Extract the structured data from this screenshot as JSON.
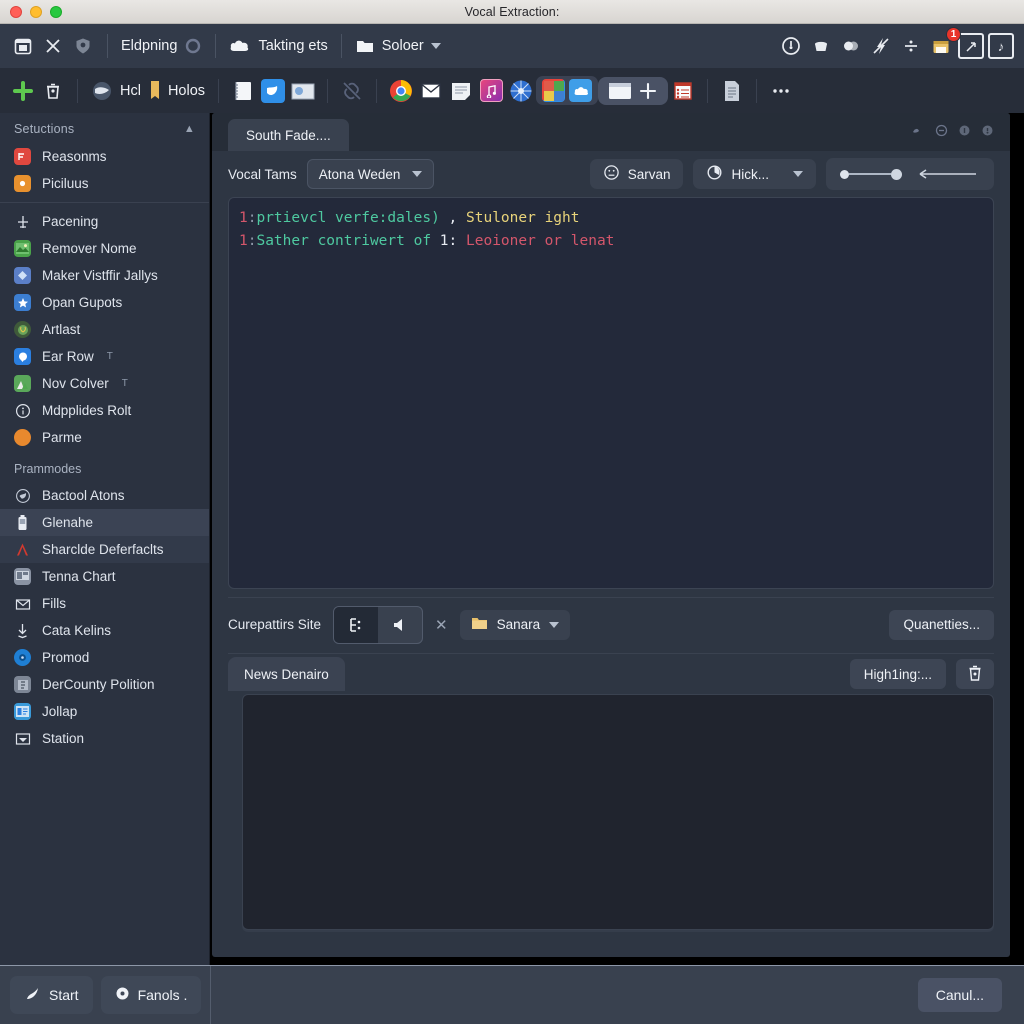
{
  "window": {
    "title": "Vocal Extraction:",
    "traffic_lights": [
      "close",
      "minimize",
      "zoom"
    ]
  },
  "toolbar_top": {
    "left_icons": [
      "calendar-icon",
      "close-icon",
      "shield-icon"
    ],
    "groups": [
      {
        "label": "Eldpning",
        "icon": "ring-icon"
      },
      {
        "label": "Takting ets",
        "icon": "cloud-icon"
      },
      {
        "label": "Soloer",
        "icon": "folder-icon",
        "caret": true
      }
    ],
    "right_icons": [
      "clock-icon",
      "bucket-icon",
      "contrast-icon",
      "flash-icon",
      "divide-icon",
      "archive-warning-icon",
      "expand-icon",
      "note-icon"
    ],
    "badge_count": "1"
  },
  "toolbar_second": {
    "add_icon": "plus-icon",
    "delete_icon": "trash-icon",
    "groups": [
      {
        "label": "Hcl",
        "icon": "globe-icon"
      },
      {
        "label": "Holos",
        "icon": "bookmark-icon"
      }
    ],
    "app_icons": [
      "notebook-icon",
      "blue-bird-icon",
      "photo-icon",
      "link-broken-icon",
      "chrome-icon",
      "mail-icon",
      "notes-icon",
      "music-icon",
      "compass-icon",
      "colors-icon",
      "cloud-app-icon"
    ],
    "window_group": [
      "window-icon",
      "plus-icon"
    ],
    "film_icon": "film-icon",
    "doc_icon": "document-icon",
    "overflow_icon": "more-icon"
  },
  "sidebar": {
    "section1_title": "Setuctions",
    "section1_collapse_icon": "chevron-up-icon",
    "group_a": [
      {
        "label": "Reasonms",
        "icon": "red-chart-icon",
        "color": "#e0483f"
      },
      {
        "label": "Piciluus",
        "icon": "orange-dot-icon",
        "color": "#e8912e"
      }
    ],
    "group_b": [
      {
        "label": "Pacening",
        "icon": "plane-icon",
        "color": "#2b3240"
      },
      {
        "label": "Remover Nome",
        "icon": "image-icon",
        "color": "#4aa34a"
      },
      {
        "label": "Maker Vistffir Jallys",
        "icon": "diamond-icon",
        "color": "#5b7fc7"
      },
      {
        "label": "Opan Gupots",
        "icon": "star-icon",
        "color": "#3c7ed1"
      },
      {
        "label": "Artlast",
        "icon": "brain-icon",
        "color": "#3f5a3a"
      },
      {
        "label": "Ear Row",
        "icon": "chat-icon",
        "color": "#2b7fe0",
        "suffix": "T"
      },
      {
        "label": "Nov Colver",
        "icon": "mountain-icon",
        "color": "#5aa85a",
        "suffix": "T"
      },
      {
        "label": "Mdpplides Rolt",
        "icon": "info-icon",
        "color": "#2b3240"
      },
      {
        "label": "Parme",
        "icon": "orange-circle-icon",
        "color": "#e8892e"
      }
    ],
    "section2_title": "Prammodes",
    "group_c": [
      {
        "label": "Bactool Atons",
        "icon": "bird-circle-icon",
        "color": "#2b3240"
      },
      {
        "label": "Glenahe",
        "icon": "battery-icon",
        "color": "#2b3240",
        "selected": true
      },
      {
        "label": "Sharclde Deferfaclts",
        "icon": "autocad-icon",
        "color": "#2b3240",
        "selected2": true
      },
      {
        "label": "Tenna Chart",
        "icon": "monitor-icon",
        "color": "#8a93a3"
      },
      {
        "label": "Fills",
        "icon": "envelope-icon",
        "color": "#2b3240"
      },
      {
        "label": "Cata Kelins",
        "icon": "download-icon",
        "color": "#2b3240"
      },
      {
        "label": "Promod",
        "icon": "blue-disc-icon",
        "color": "#1f7fd4"
      },
      {
        "label": "DerCounty Polition",
        "icon": "gray-card-icon",
        "color": "#7d8695"
      },
      {
        "label": "Jollap",
        "icon": "blue-card-icon",
        "color": "#3a9ad9"
      },
      {
        "label": "Station",
        "icon": "check-box-icon",
        "color": "#2b3240"
      }
    ]
  },
  "main": {
    "tab_label": "South Fade....",
    "tab_icons": [
      "mask-icon",
      "minus-circle-icon",
      "left-dot-icon",
      "right-dot-icon"
    ],
    "toolbar": {
      "field_label": "Vocal Tams",
      "select_value": "Atona Weden",
      "button_label": "Sarvan",
      "button_icon": "face-clock-icon",
      "dropdown_label": "Hick...",
      "dropdown_icon": "pie-icon",
      "slider_value": "50",
      "arrow_icon": "arrow-left-icon"
    },
    "editor": {
      "lines": [
        {
          "number": "1",
          "tokens": [
            {
              "text": "prtievcl verfe:dales)",
              "color": "green"
            },
            {
              "text": " , ",
              "color": "white"
            },
            {
              "text": "Stuloner ight",
              "color": "yellow"
            }
          ]
        },
        {
          "number": "1",
          "tokens": [
            {
              "text": "Sather contriwert of ",
              "color": "green"
            },
            {
              "text": " 1: ",
              "color": "white"
            },
            {
              "text": "Leoioner or lenat",
              "color": "red"
            }
          ]
        }
      ]
    },
    "compat_row": {
      "label": "Curepattirs Site",
      "segment": [
        {
          "icon": "list-icon",
          "active": true
        },
        {
          "icon": "speaker-icon",
          "active": false
        }
      ],
      "close_icon": "x-icon",
      "folder_label": "Sanara",
      "folder_icon": "folder-icon",
      "action_label": "Quanetties..."
    },
    "lower": {
      "tab_label": "News Denairo",
      "action_label": "High1ing:...",
      "trash_icon": "trash-icon"
    }
  },
  "status": {
    "start_label": "Start",
    "start_icon": "flag-icon",
    "second_label": "Fanols .",
    "second_icon": "disc-icon",
    "cancel_label": "Canul..."
  }
}
